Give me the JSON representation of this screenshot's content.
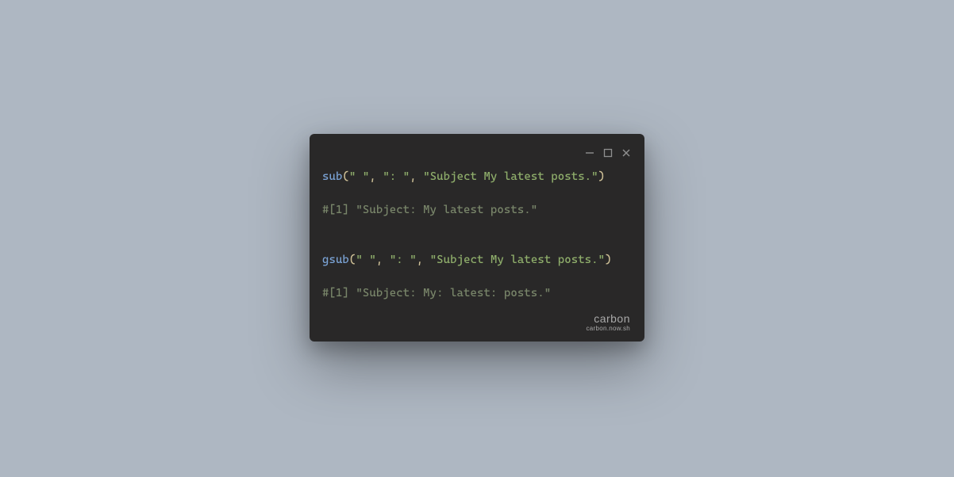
{
  "window": {
    "controls": {
      "minimize": "−",
      "maximize": "☐",
      "close": "✕"
    }
  },
  "code": {
    "line1": {
      "fn": "sub",
      "p_open": "(",
      "arg1": "\" \"",
      "c1": ", ",
      "arg2": "\": \"",
      "c2": ", ",
      "arg3": "\"Subject My latest posts.\"",
      "p_close": ")"
    },
    "line2": "",
    "line3": {
      "comment": "#[1] \"Subject: My latest posts.\""
    },
    "line4": "",
    "line5": "",
    "line6": {
      "fn": "gsub",
      "p_open": "(",
      "arg1": "\" \"",
      "c1": ", ",
      "arg2": "\": \"",
      "c2": ", ",
      "arg3": "\"Subject My latest posts.\"",
      "p_close": ")"
    },
    "line7": "",
    "line8": {
      "comment": "#[1] \"Subject: My: latest: posts.\""
    }
  },
  "watermark": {
    "brand": "carbon",
    "sub": "carbon.now.sh"
  }
}
